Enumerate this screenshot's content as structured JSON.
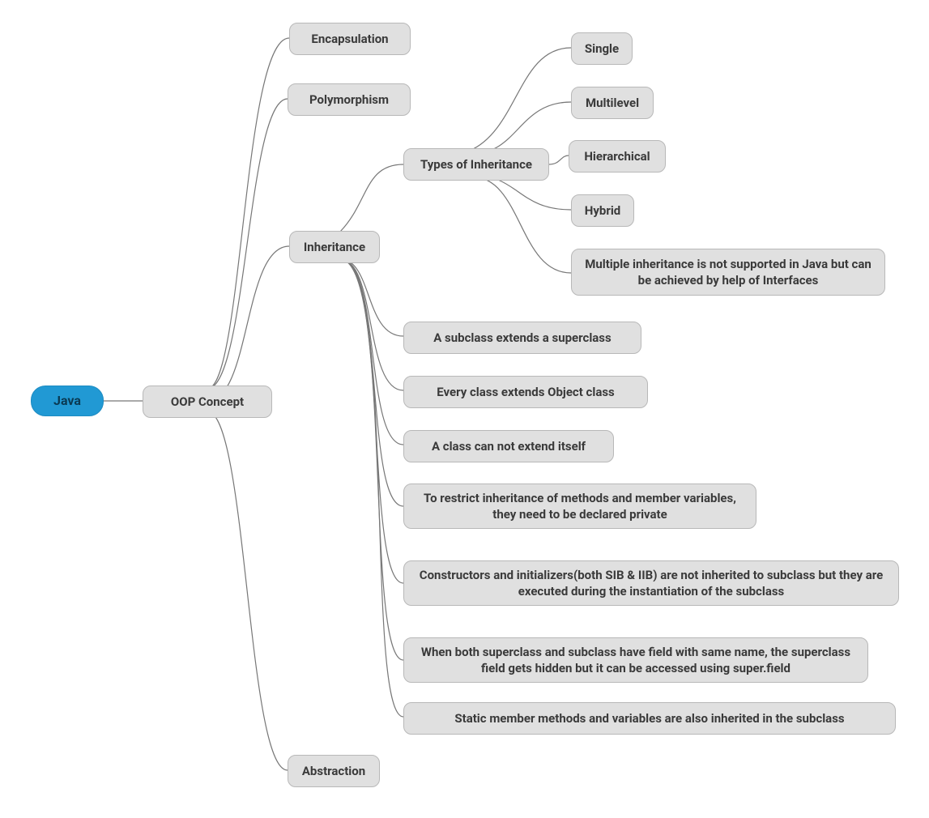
{
  "root": {
    "label": "Java"
  },
  "oop": {
    "label": "OOP Concept"
  },
  "encapsulation": {
    "label": "Encapsulation"
  },
  "polymorphism": {
    "label": "Polymorphism"
  },
  "inheritance": {
    "label": "Inheritance"
  },
  "abstraction": {
    "label": "Abstraction"
  },
  "types_title": {
    "label": "Types of Inheritance"
  },
  "types": {
    "single": "Single",
    "multilevel": "Multilevel",
    "hierarchical": "Hierarchical",
    "hybrid": "Hybrid",
    "multiple_note": "Multiple inheritance is not supported in Java but can be achieved by help of Interfaces"
  },
  "inheritance_notes": {
    "n1": "A subclass extends a superclass",
    "n2": "Every class extends Object class",
    "n3": "A class can not extend itself",
    "n4": "To restrict inheritance of methods and member variables, they need to be declared private",
    "n5": "Constructors and initializers(both SIB & IIB) are not inherited to subclass but they are executed during the instantiation of the subclass",
    "n6": "When both superclass and subclass have field with same name, the superclass field gets hidden but it can be accessed using super.field",
    "n7": "Static member methods and variables are also inherited in the subclass"
  },
  "colors": {
    "node_bg": "#e0e0e0",
    "node_border": "#b8b8b8",
    "root_bg": "#2199d4",
    "connector": "#777777"
  }
}
